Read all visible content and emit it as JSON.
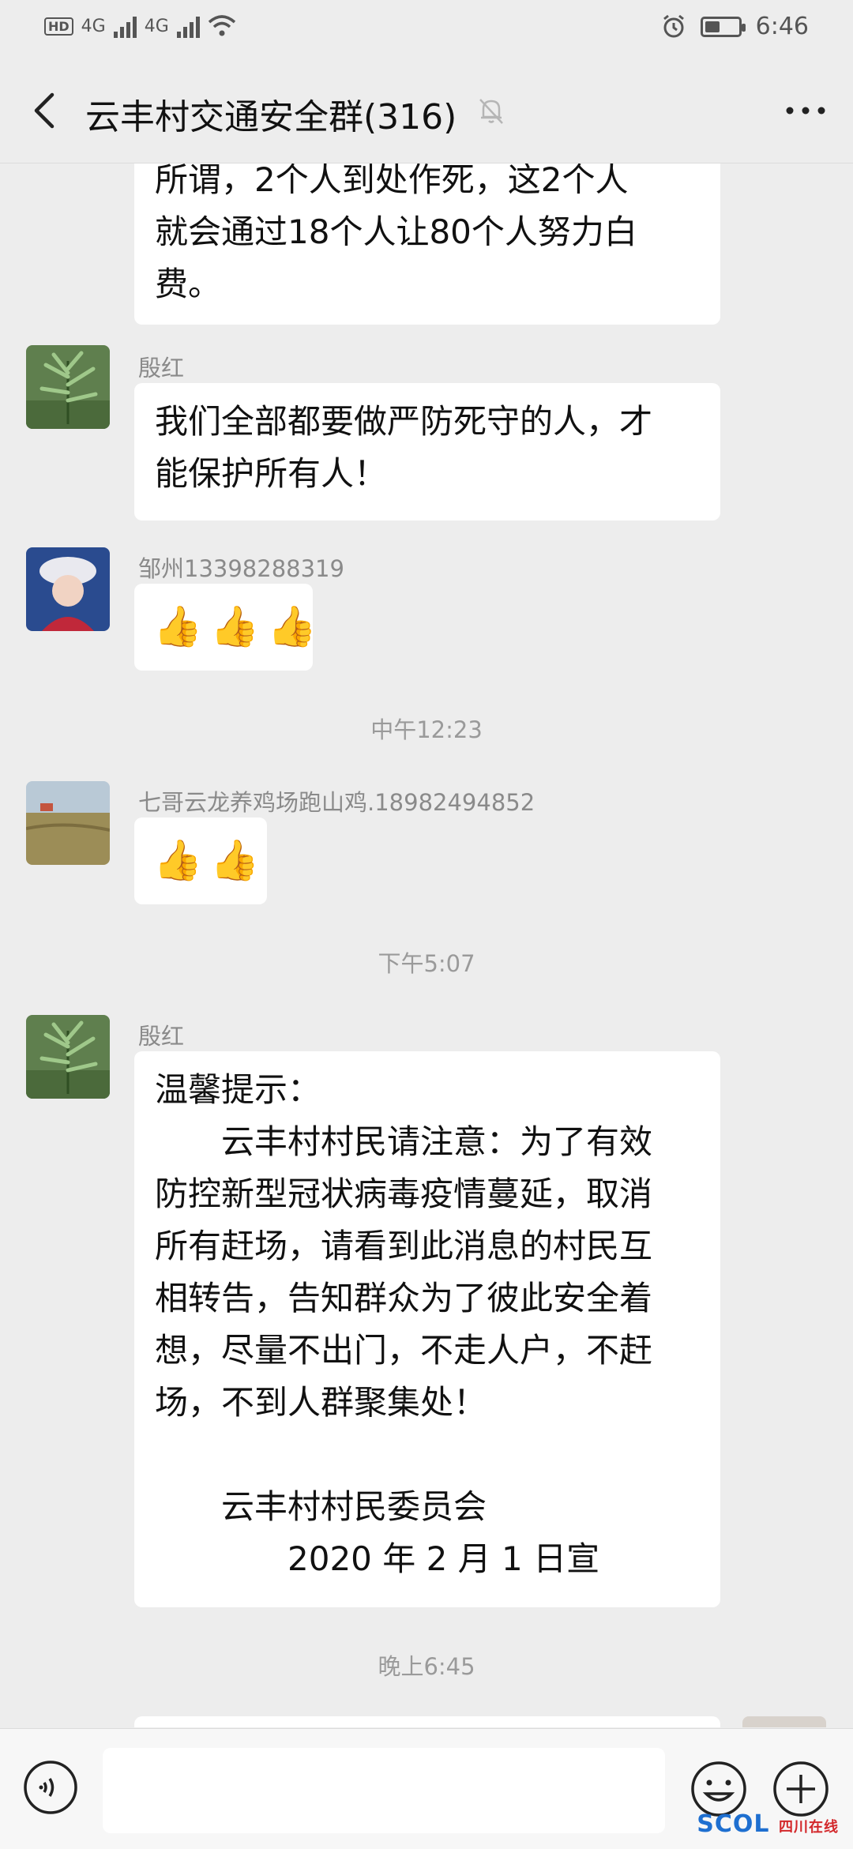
{
  "status_bar": {
    "net1": "4G",
    "net2": "4G",
    "time": "6:46",
    "battery_level": 0.45
  },
  "header": {
    "title": "云丰村交通安全群(316)"
  },
  "messages": {
    "m0_lines": [
      "所谓，2个人到处作死，这2个人",
      "就会通过18个人让80个人努力白",
      "费。"
    ],
    "m1_sender": "殷红",
    "m1_lines": [
      "我们全部都要做严防死守的人，才",
      "能保护所有人！"
    ],
    "m2_sender": "邹州13398288319",
    "time1": "中午12:23",
    "m3_sender": "七哥云龙养鸡场跑山鸡.18982494852",
    "time2": "下午5:07",
    "m4_sender": "殷红",
    "m4_lines": [
      "温馨提示：",
      "　　云丰村村民请注意：为了有效",
      "防控新型冠状病毒疫情蔓延，取消",
      "所有赶场，请看到此消息的村民互",
      "相转告，告知群众为了彼此安全着",
      "想，尽量不出门，不走人户，不赶",
      "场，不到人群聚集处！",
      "",
      "　　云丰村村民委员会",
      "　　　　2020 年 2 月 1 日宣"
    ],
    "time3": "晚上6:45"
  },
  "watermark": {
    "text": "SCOL",
    "sub": "四川在线"
  },
  "colors": {
    "background": "#ededed",
    "bubble": "#ffffff",
    "meta_text": "#8a8a8a"
  }
}
